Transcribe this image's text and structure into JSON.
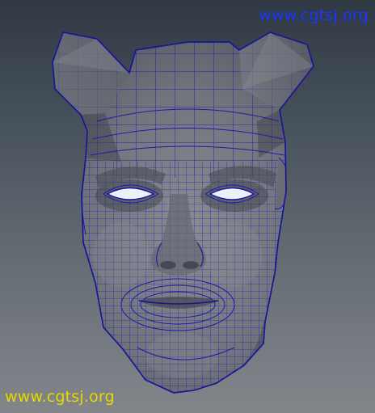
{
  "viewport": {
    "model": "head-mesh",
    "wire_color": "#1a1aa6",
    "face_color": "#74767f",
    "shadow_color": "#4f525b",
    "highlight_color": "#8b8d95"
  },
  "watermarks": {
    "top_text": "www.cgtsj.org",
    "top_color": "#1a36ff",
    "bottom_text": "www.cgtsj.org",
    "bottom_color": "#e8d800"
  }
}
